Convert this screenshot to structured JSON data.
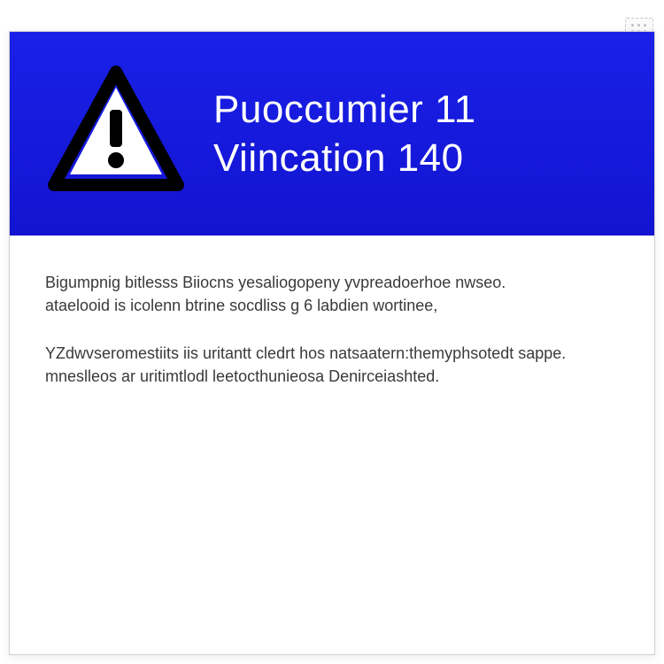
{
  "banner": {
    "line1": "Puoccumier 11",
    "line2": "Viincation 140"
  },
  "body": {
    "para1_line1": "Bigumpnig bitlesss Biiocns yesaliogopeny yvpreadoerhoe nwseo.",
    "para1_line2": "ataelooid is icolenn btrine socdliss g 6 labdien wortinee,",
    "para2_line1": "YZdwvseromestiits iis uritantt cledrt hos natsaatern:themyphsotedt sappe.",
    "para2_line2": "mneslleos ar uritimtlodl leetocthunieosa Denirceiashted."
  },
  "colors": {
    "banner_blue": "#1418d8",
    "text_body": "#3a3a3a",
    "text_banner": "#ffffff"
  }
}
